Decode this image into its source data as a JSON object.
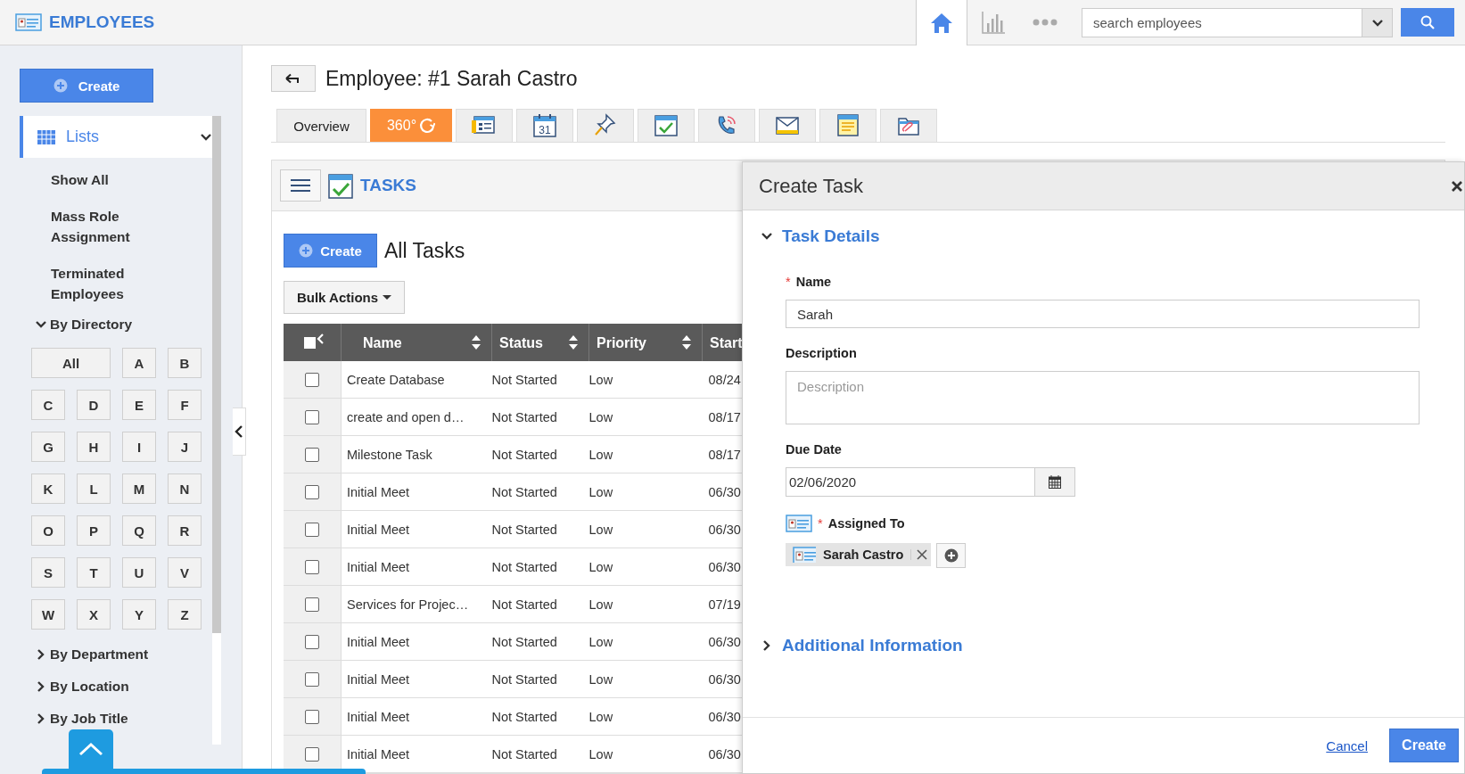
{
  "app": {
    "title": "EMPLOYEES"
  },
  "top_nav": [
    {
      "kind": "home",
      "selected": true
    },
    {
      "kind": "chart",
      "selected": false
    },
    {
      "kind": "more",
      "selected": false
    }
  ],
  "search": {
    "placeholder": "search employees"
  },
  "sidebar": {
    "create_button": "Create",
    "lists": {
      "label": "Lists",
      "expanded": true
    },
    "items": [
      "Show All",
      "Mass Role Assignment",
      "Terminated Employees"
    ],
    "directory": {
      "label": "By Directory",
      "expanded": true,
      "letters": [
        "All",
        "A",
        "B",
        "C",
        "D",
        "E",
        "F",
        "G",
        "H",
        "I",
        "J",
        "K",
        "L",
        "M",
        "N",
        "O",
        "P",
        "Q",
        "R",
        "S",
        "T",
        "U",
        "V",
        "W",
        "X",
        "Y",
        "Z"
      ]
    },
    "groups": [
      {
        "label": "By Department",
        "expanded": false
      },
      {
        "label": "By Location",
        "expanded": false
      },
      {
        "label": "By Job Title",
        "expanded": false
      }
    ]
  },
  "page": {
    "title": "Employee: #1 Sarah Castro"
  },
  "tabs": [
    {
      "kind": "text",
      "label": "Overview",
      "selected": false
    },
    {
      "kind": "panorama",
      "label": "360°",
      "selected": true
    },
    {
      "kind": "profile",
      "selected": false
    },
    {
      "kind": "calendar",
      "label": "31",
      "selected": false
    },
    {
      "kind": "pin",
      "selected": false
    },
    {
      "kind": "tasks",
      "selected": false
    },
    {
      "kind": "phone",
      "selected": false
    },
    {
      "kind": "mail",
      "selected": false
    },
    {
      "kind": "notes",
      "selected": false
    },
    {
      "kind": "attachment",
      "selected": false
    }
  ],
  "tasks_panel": {
    "title": "TASKS",
    "create_button": "Create",
    "list_title": "All Tasks",
    "bulk_actions": "Bulk Actions",
    "select_all_checked": false,
    "columns": [
      {
        "label": "Name",
        "sortable": true
      },
      {
        "label": "Status",
        "sortable": true
      },
      {
        "label": "Priority",
        "sortable": true
      },
      {
        "label": "Start"
      }
    ],
    "rows": [
      {
        "checked": false,
        "cells": [
          "Create Database",
          "Not Started",
          "Low",
          "08/24"
        ]
      },
      {
        "checked": false,
        "cells": [
          "create and open d…",
          "Not Started",
          "Low",
          "08/17"
        ]
      },
      {
        "checked": false,
        "cells": [
          "Milestone Task",
          "Not Started",
          "Low",
          "08/17"
        ]
      },
      {
        "checked": false,
        "cells": [
          "Initial Meet",
          "Not Started",
          "Low",
          "06/30"
        ]
      },
      {
        "checked": false,
        "cells": [
          "Initial Meet",
          "Not Started",
          "Low",
          "06/30"
        ]
      },
      {
        "checked": false,
        "cells": [
          "Initial Meet",
          "Not Started",
          "Low",
          "06/30"
        ]
      },
      {
        "checked": false,
        "cells": [
          "Services for Projec…",
          "Not Started",
          "Low",
          "07/19"
        ]
      },
      {
        "checked": false,
        "cells": [
          "Initial Meet",
          "Not Started",
          "Low",
          "06/30"
        ]
      },
      {
        "checked": false,
        "cells": [
          "Initial Meet",
          "Not Started",
          "Low",
          "06/30"
        ]
      },
      {
        "checked": false,
        "cells": [
          "Initial Meet",
          "Not Started",
          "Low",
          "06/30"
        ]
      },
      {
        "checked": false,
        "cells": [
          "Initial Meet",
          "Not Started",
          "Low",
          "06/30"
        ]
      }
    ]
  },
  "dialog": {
    "title": "Create Task",
    "details": {
      "title": "Task Details",
      "expanded": true
    },
    "name": {
      "label": "Name",
      "required_mark": "*",
      "value": "Sarah"
    },
    "description": {
      "label": "Description",
      "placeholder": "Description"
    },
    "due_date": {
      "label": "Due Date",
      "value": "02/06/2020"
    },
    "assigned_to": {
      "label": "Assigned To",
      "required_mark": "*",
      "chips": [
        "Sarah Castro"
      ]
    },
    "additional": {
      "title": "Additional Information",
      "expanded": false
    },
    "cancel": "Cancel",
    "create": "Create"
  }
}
